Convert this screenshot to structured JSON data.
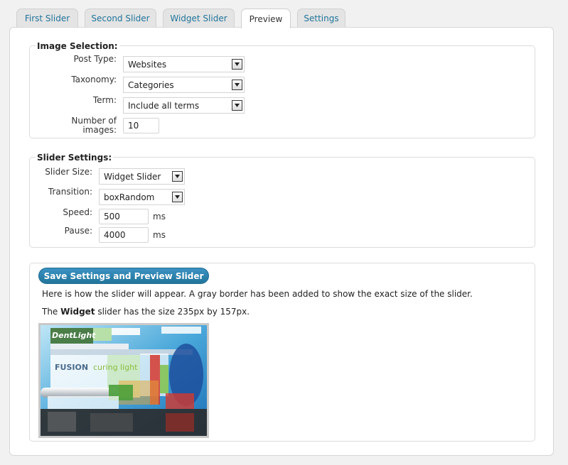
{
  "tabs": [
    {
      "label": "First Slider"
    },
    {
      "label": "Second Slider"
    },
    {
      "label": "Widget Slider"
    },
    {
      "label": "Preview"
    },
    {
      "label": "Settings"
    }
  ],
  "image_selection": {
    "legend": "Image Selection:",
    "post_type": {
      "label": "Post Type:",
      "value": "Websites"
    },
    "taxonomy": {
      "label": "Taxonomy:",
      "value": "Categories"
    },
    "term": {
      "label": "Term:",
      "value": "Include all terms"
    },
    "number": {
      "label_line1": "Number of",
      "label_line2": "images:",
      "value": "10"
    }
  },
  "slider_settings": {
    "legend": "Slider Settings:",
    "size": {
      "label": "Slider Size:",
      "value": "Widget Slider"
    },
    "transition": {
      "label": "Transition:",
      "value": "boxRandom"
    },
    "speed": {
      "label": "Speed:",
      "value": "500",
      "unit": "ms"
    },
    "pause": {
      "label": "Pause:",
      "value": "4000",
      "unit": "ms"
    }
  },
  "preview": {
    "button_label": "Save Settings and Preview Slider",
    "description": "Here is how the slider will appear. A gray border has been added to show the exact size of the slider.",
    "size_prefix": "The ",
    "size_slider_name": "Widget",
    "size_suffix": " slider has the size 235px by 157px.",
    "image_text": {
      "logo": "DentLight",
      "headline_a": "FUSION",
      "headline_b": "curing light"
    }
  },
  "colors": {
    "accent": "#21759b",
    "tab_bg": "#e4e4e4",
    "panel_border": "#d7d7d7"
  }
}
